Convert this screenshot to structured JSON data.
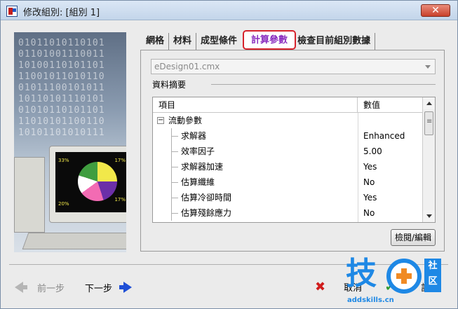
{
  "window": {
    "title": "修改組別: [組別 1]",
    "close_label": "✕"
  },
  "side_image": {
    "binary_lines": [
      "01011010110101",
      "01101001110011",
      "10100110101101",
      "11001011010110",
      "01011100101011",
      "10110101110101",
      "01010110101101",
      "11010101100110",
      "10101101010111"
    ],
    "pie_labels": [
      "33%",
      "17%",
      "20%",
      "17%"
    ]
  },
  "tabs": [
    {
      "label": "網格",
      "active": false
    },
    {
      "label": "材料",
      "active": false
    },
    {
      "label": "成型條件",
      "active": false
    },
    {
      "label": "計算參數",
      "active": true
    },
    {
      "label": "檢查目前組別數據",
      "active": false
    }
  ],
  "panel": {
    "design_select_value": "eDesign01.cmx",
    "summary_label": "資料摘要",
    "table": {
      "headers": [
        "項目",
        "數值"
      ],
      "group": {
        "expander": "−",
        "label": "流動參數"
      },
      "rows": [
        {
          "label": "求解器",
          "value": "Enhanced"
        },
        {
          "label": "效率因子",
          "value": "5.00"
        },
        {
          "label": "求解器加速",
          "value": "Yes"
        },
        {
          "label": "估算纖維",
          "value": "No"
        },
        {
          "label": "估算冷卻時間",
          "value": "Yes"
        },
        {
          "label": "估算殘餘應力",
          "value": "No"
        }
      ]
    },
    "edit_button": "檢閱/編輯"
  },
  "footer": {
    "prev_label": "前一步",
    "next_label": "下一步",
    "cancel_label": "取消",
    "ok_fragment": "記"
  },
  "watermark": {
    "glyph": "技",
    "tag": "社区",
    "url": "addskills.cn"
  },
  "colors": {
    "highlight_border": "#d6222b",
    "active_tab_text": "#8a2dbf",
    "next_arrow": "#1f4fd6",
    "cancel_x": "#d01d1d",
    "watermark_blue": "#1e88e5",
    "watermark_orange": "#f08a24"
  }
}
